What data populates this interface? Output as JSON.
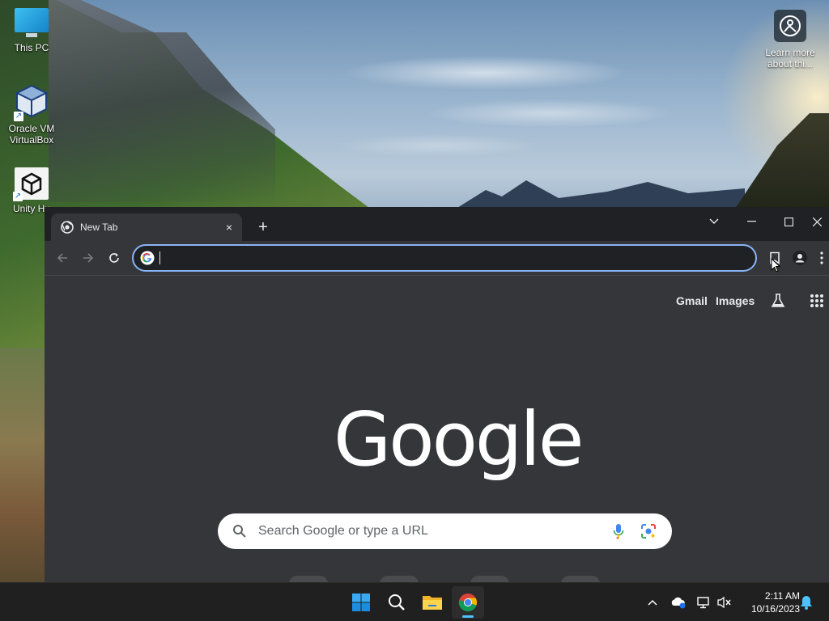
{
  "desktop": {
    "icons": [
      {
        "label": "This PC"
      },
      {
        "label": "Oracle VM VirtualBox"
      },
      {
        "label": "Unity Hu"
      }
    ],
    "learn_more": {
      "label": "Learn more about thi..."
    }
  },
  "browser": {
    "tab": {
      "title": "New Tab",
      "close": "×"
    },
    "new_tab_label": "+",
    "omnibox": {
      "value": "",
      "placeholder": ""
    },
    "ntp": {
      "gmail_label": "Gmail",
      "images_label": "Images",
      "logo_text": "Google",
      "search_placeholder": "Search Google or type a URL"
    },
    "icons": {
      "back": "arrow-left-icon",
      "forward": "arrow-right-icon",
      "reload": "reload-icon",
      "bookmark": "bookmark-icon",
      "profile": "profile-icon",
      "menu": "kebab-menu-icon",
      "labs": "flask-icon",
      "apps": "apps-grid-icon",
      "mic": "microphone-icon",
      "lens": "lens-icon"
    },
    "colors": {
      "accent": "#8ab4f8",
      "bg": "#35363a",
      "tabstrip": "#202124"
    }
  },
  "taskbar": {
    "apps": [
      "start-icon",
      "search-icon",
      "file-explorer-icon",
      "chrome-icon"
    ],
    "clock": {
      "time": "2:11 AM",
      "date": "10/16/2023"
    },
    "accent": "#4cc2ff"
  }
}
